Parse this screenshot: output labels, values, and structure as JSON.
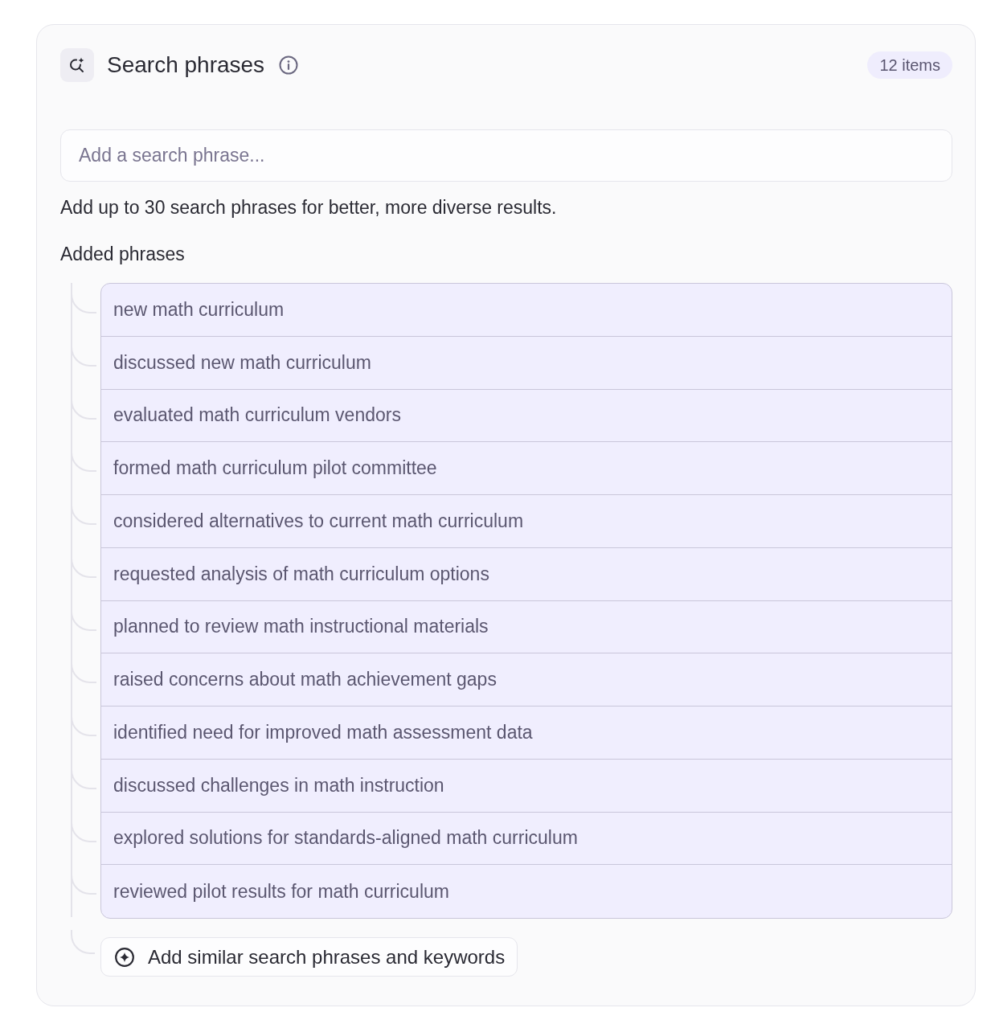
{
  "panel": {
    "title": "Search phrases",
    "count_badge": "12 items",
    "search": {
      "placeholder": "Add a search phrase..."
    },
    "help_text": "Add up to 30 search phrases for better, more diverse results.",
    "section_label": "Added phrases",
    "phrases": [
      "new math curriculum",
      "discussed new math curriculum",
      "evaluated math curriculum vendors",
      "formed math curriculum pilot committee",
      "considered alternatives to current math curriculum",
      "requested analysis of math curriculum options",
      "planned to review math instructional materials",
      "raised concerns about math achievement gaps",
      "identified need for improved math assessment data",
      "discussed challenges in math instruction",
      "explored solutions for standards-aligned math curriculum",
      "reviewed pilot results for math curriculum"
    ],
    "add_similar_button": "Add similar search phrases and keywords"
  }
}
